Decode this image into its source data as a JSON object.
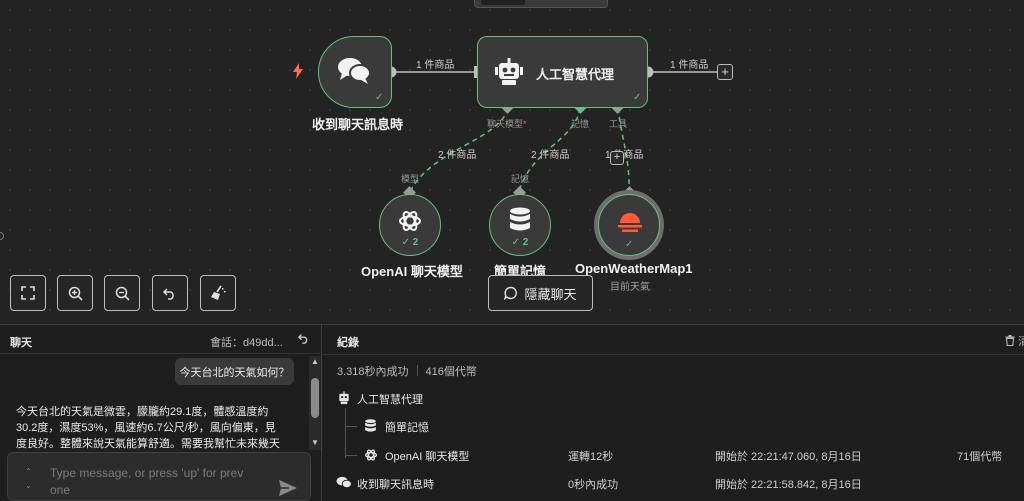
{
  "canvas": {
    "trigger_node": {
      "label": "收到聊天訊息時",
      "icon": "chat-bubbles-icon",
      "trigger_icon": "lightning-bolt-icon"
    },
    "agent_node": {
      "label": "人工智慧代理",
      "icon": "robot-icon"
    },
    "openai_node": {
      "label": "OpenAI 聊天模型",
      "count": "2",
      "icon": "openai-icon"
    },
    "memory_node": {
      "label": "簡單記憶",
      "count": "2",
      "icon": "database-icon"
    },
    "weather_node": {
      "label": "OpenWeatherMap1",
      "sublabel": "目前天氣",
      "icon": "sun-icon"
    },
    "edges": {
      "trigger_to_agent": "1 件商品",
      "agent_output": "1 件商品",
      "model": "2 件商品",
      "memory": "2 件商品",
      "tool": "1 件商品"
    },
    "ports": {
      "chat_model": "聊天模型",
      "chat_model_required": "*",
      "memory": "記憶",
      "tool": "工具",
      "model_in": "模型",
      "memory_in": "記憶"
    },
    "controls": {
      "fit_view": "fit-view-icon",
      "zoom_in": "zoom-in-icon",
      "zoom_out": "zoom-out-icon",
      "reset": "undo-icon",
      "clean": "broom-icon",
      "hide_chat_label": "隱藏聊天"
    },
    "colors": {
      "success": "#6bbd84",
      "accent": "#ff6d5a"
    }
  },
  "chat": {
    "title": "聊天",
    "session": "會話：d49dd...",
    "user_message": "今天台北的天氣如何？",
    "bot_message": "今天台北的天氣是微雲，朦朧約29.1度，體感溫度約30.2度，濕度53%，風速約6.7公尺/秒，風向偏東，見度良好。整體來說天氣能算舒適。需要我幫忙未來幾天天氣",
    "input_placeholder": "Type message, or press 'up' for prev one"
  },
  "logs": {
    "title": "紀錄",
    "clear_label": "清",
    "summary_time": "3.318秒內成功",
    "summary_tokens": "416個代幣",
    "rows": [
      {
        "name": "人工智慧代理",
        "icon": "robot-icon",
        "duration": "",
        "start": "",
        "tokens": ""
      },
      {
        "name": "簡單記憶",
        "icon": "database-icon",
        "duration": "",
        "start": "",
        "tokens": ""
      },
      {
        "name": "OpenAI 聊天模型",
        "icon": "openai-icon",
        "duration": "運轉12秒",
        "start": "開始於 22:21:47.060, 8月16日",
        "tokens": "71個代幣"
      },
      {
        "name": "收到聊天訊息時",
        "icon": "chat-bubbles-icon",
        "duration": "0秒內成功",
        "start": "開始於 22:21:58.842, 8月16日",
        "tokens": ""
      }
    ]
  }
}
